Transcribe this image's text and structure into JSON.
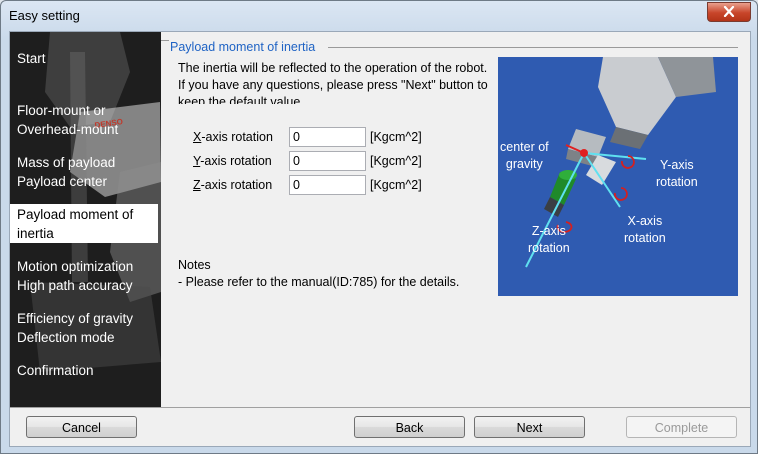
{
  "window": {
    "title": "Easy setting"
  },
  "sidebar": {
    "brand": "DENSO",
    "items": [
      {
        "label": "Start",
        "active": false
      },
      {
        "line1": "Floor-mount or",
        "line2": "Overhead-mount",
        "active": false
      },
      {
        "line1": "Mass of payload",
        "line2": "Payload center",
        "active": false
      },
      {
        "line1": "Payload moment of",
        "line2": "inertia",
        "active": true
      },
      {
        "line1": "Motion optimization",
        "line2": "High path accuracy",
        "active": false
      },
      {
        "line1": "Efficiency of gravity",
        "line2": "Deflection mode",
        "active": false
      },
      {
        "label": "Confirmation",
        "active": false
      }
    ]
  },
  "section": {
    "title": "Payload moment of inertia",
    "description": "The inertia will be reflected to the operation of the robot.\nIf you have any questions, please press \"Next\" button to keep the default value."
  },
  "fields": [
    {
      "key": "X",
      "rest": "-axis rotation",
      "value": "0",
      "unit": "[Kgcm^2]"
    },
    {
      "key": "Y",
      "rest": "-axis rotation",
      "value": "0",
      "unit": "[Kgcm^2]"
    },
    {
      "key": "Z",
      "rest": "-axis rotation",
      "value": "0",
      "unit": "[Kgcm^2]"
    }
  ],
  "notes": {
    "heading": "Notes",
    "text": "- Please refer to the manual(ID:785) for the details."
  },
  "diagram": {
    "cog_line1": "center of",
    "cog_line2": "gravity",
    "y_line1": "Y-axis",
    "y_line2": "rotation",
    "x_line1": "X-axis",
    "x_line2": "rotation",
    "z_line1": "Z-axis",
    "z_line2": "rotation",
    "colors": {
      "background": "#2f5bb1",
      "axis": "#5fe0f0",
      "marker": "#e02020",
      "rotation_arrow": "#d42020"
    }
  },
  "buttons": {
    "cancel": "Cancel",
    "back": "Back",
    "next": "Next",
    "complete": "Complete"
  }
}
